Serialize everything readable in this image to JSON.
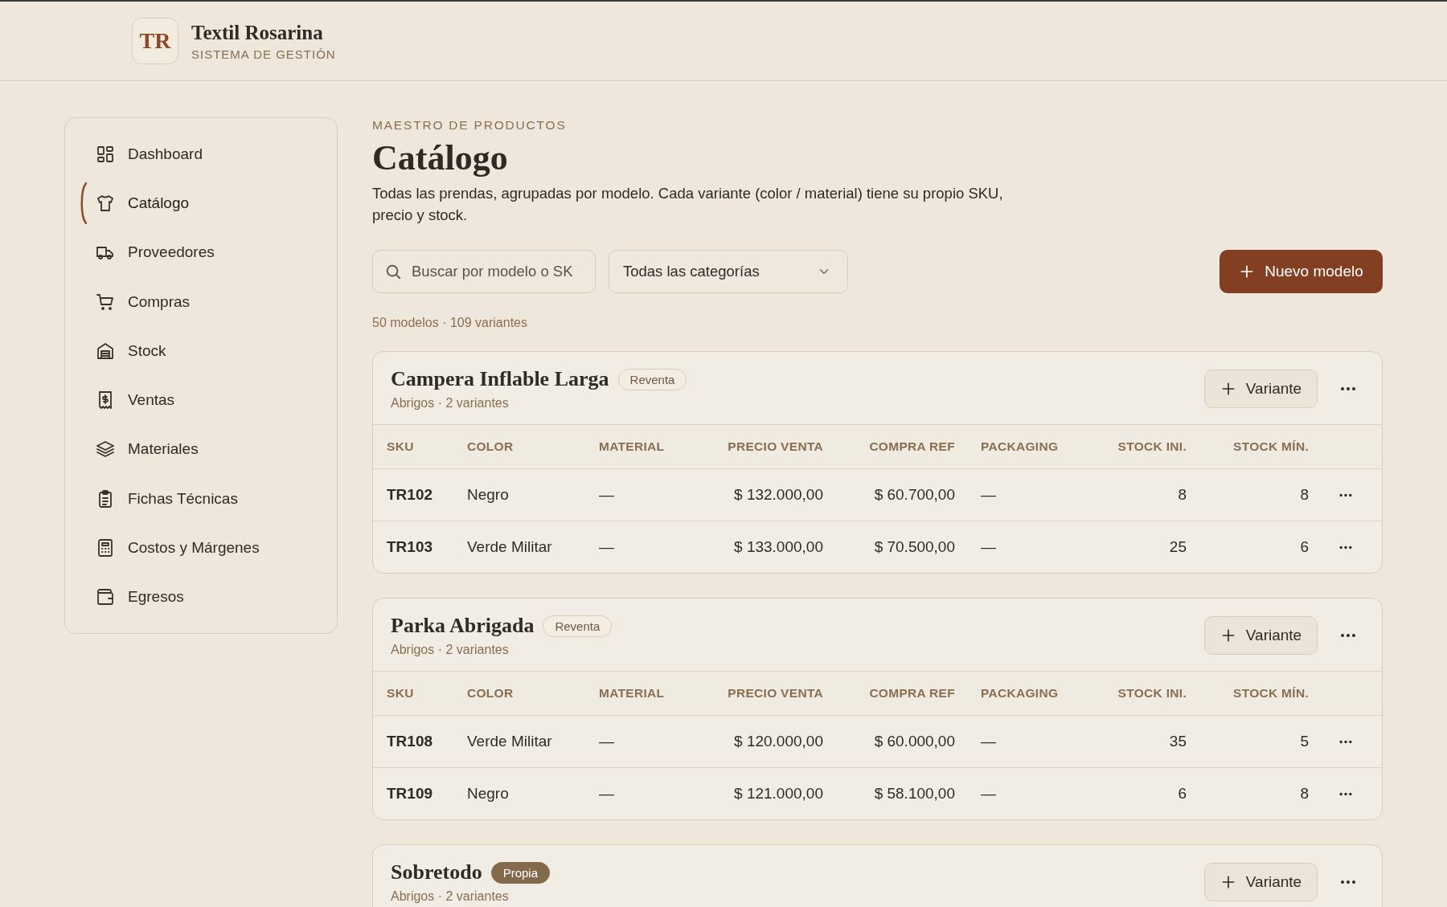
{
  "brand": {
    "logo": "TR",
    "name": "Textil Rosarina",
    "subtitle": "SISTEMA DE GESTIÓN"
  },
  "sidebar": {
    "items": [
      {
        "label": "Dashboard",
        "selected": false
      },
      {
        "label": "Catálogo",
        "selected": true
      },
      {
        "label": "Proveedores",
        "selected": false
      },
      {
        "label": "Compras",
        "selected": false
      },
      {
        "label": "Stock",
        "selected": false
      },
      {
        "label": "Ventas",
        "selected": false
      },
      {
        "label": "Materiales",
        "selected": false
      },
      {
        "label": "Fichas Técnicas",
        "selected": false
      },
      {
        "label": "Costos y Márgenes",
        "selected": false
      },
      {
        "label": "Egresos",
        "selected": false
      }
    ]
  },
  "page": {
    "eyebrow": "MAESTRO DE PRODUCTOS",
    "title": "Catálogo",
    "description": "Todas las prendas, agrupadas por modelo. Cada variante (color / material) tiene su propio SKU, precio y stock."
  },
  "toolbar": {
    "search": {
      "placeholder": "Buscar por modelo o SK"
    },
    "category_select": "Todas las categorías",
    "new_button": "Nuevo modelo"
  },
  "summary": "50 modelos · 109 variantes",
  "models": [
    {
      "name": "Campera Inflable Larga",
      "tag": {
        "label": "Reventa",
        "kind": "resale"
      },
      "subtitle": "Abrigos · 2 variantes",
      "add_button": "Variante",
      "columns": [
        "SKU",
        "COLOR",
        "MATERIAL",
        "PRECIO VENTA",
        "COMPRA REF",
        "PACKAGING",
        "STOCK INI.",
        "STOCK MÍN."
      ],
      "rows": [
        {
          "cells": [
            "TR102",
            "Negro",
            "—",
            "$ 132.000,00",
            "$ 60.700,00",
            "—",
            "8",
            "8"
          ]
        },
        {
          "cells": [
            "TR103",
            "Verde Militar",
            "—",
            "$ 133.000,00",
            "$ 70.500,00",
            "—",
            "25",
            "6"
          ]
        }
      ]
    },
    {
      "name": "Parka Abrigada",
      "tag": {
        "label": "Reventa",
        "kind": "resale"
      },
      "subtitle": "Abrigos · 2 variantes",
      "add_button": "Variante",
      "columns": [
        "SKU",
        "COLOR",
        "MATERIAL",
        "PRECIO VENTA",
        "COMPRA REF",
        "PACKAGING",
        "STOCK INI.",
        "STOCK MÍN."
      ],
      "rows": [
        {
          "cells": [
            "TR108",
            "Verde Militar",
            "—",
            "$ 120.000,00",
            "$ 60.000,00",
            "—",
            "35",
            "5"
          ]
        },
        {
          "cells": [
            "TR109",
            "Negro",
            "—",
            "$ 121.000,00",
            "$ 58.100,00",
            "—",
            "6",
            "8"
          ]
        }
      ]
    },
    {
      "name": "Sobretodo",
      "tag": {
        "label": "Propia",
        "kind": "own"
      },
      "subtitle": "Abrigos · 2 variantes",
      "add_button": "Variante"
    }
  ]
}
